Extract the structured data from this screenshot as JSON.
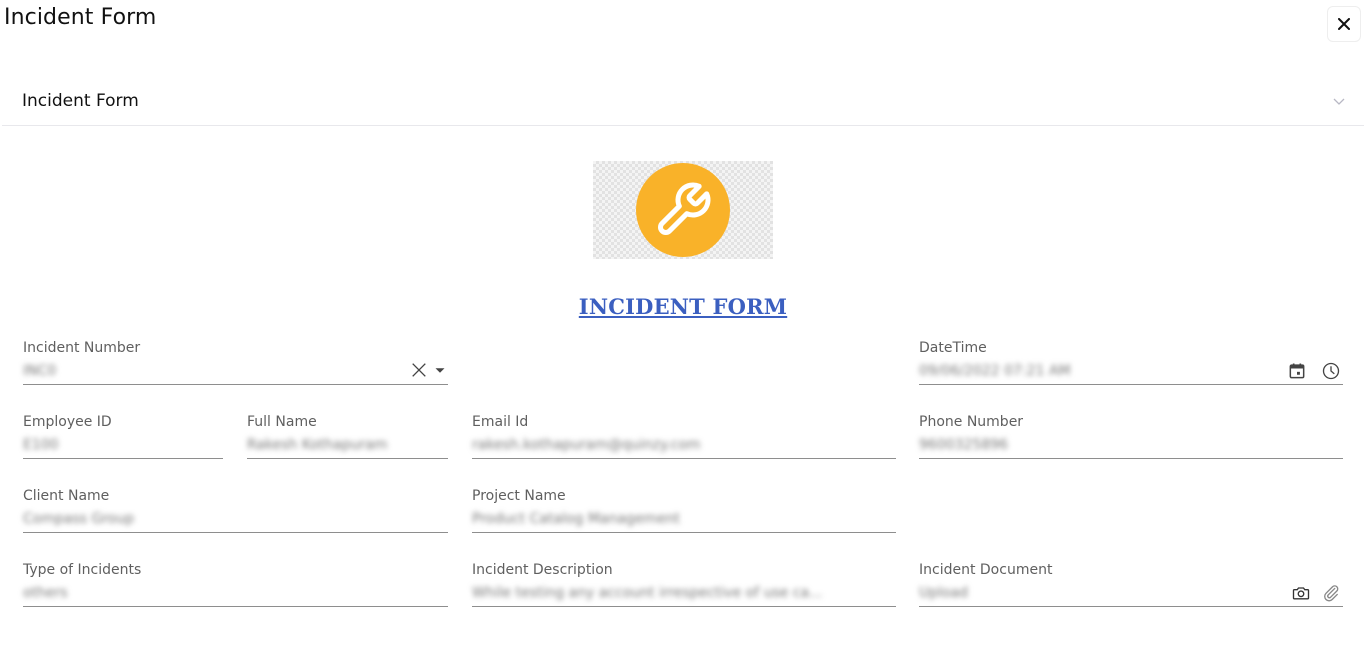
{
  "window": {
    "title": "Incident Form",
    "close_icon": "close-icon"
  },
  "section": {
    "title": "Incident Form",
    "toggle_icon": "chevron-down-icon"
  },
  "logo": {
    "icon": "wrench-icon",
    "color": "#f9b229"
  },
  "form": {
    "heading": "INCIDENT FORM",
    "heading_color": "#3b5fc0",
    "fields": {
      "incident_number": {
        "label": "Incident Number",
        "value": "INC0",
        "icons": [
          "clear-icon",
          "dropdown-arrow-icon"
        ]
      },
      "datetime": {
        "label": "DateTime",
        "value": "09/06/2022 07:21 AM",
        "icons": [
          "calendar-icon",
          "clock-icon"
        ]
      },
      "employee_id": {
        "label": "Employee ID",
        "value": "E100"
      },
      "full_name": {
        "label": "Full Name",
        "value": "Rakesh Kothapuram"
      },
      "email_id": {
        "label": "Email Id",
        "value": "rakesh.kothapuram@quinzy.com"
      },
      "phone_number": {
        "label": "Phone Number",
        "value": "9600325896"
      },
      "client_name": {
        "label": "Client Name",
        "value": "Compass Group"
      },
      "project_name": {
        "label": "Project Name",
        "value": "Product Catalog Management"
      },
      "type_of_incidents": {
        "label": "Type of Incidents",
        "value": "others"
      },
      "incident_description": {
        "label": "Incident Description",
        "value": "While testing any account irrespective of use ca..."
      },
      "incident_document": {
        "label": "Incident Document",
        "value": "Upload",
        "icons": [
          "camera-icon",
          "paperclip-icon"
        ]
      }
    }
  }
}
